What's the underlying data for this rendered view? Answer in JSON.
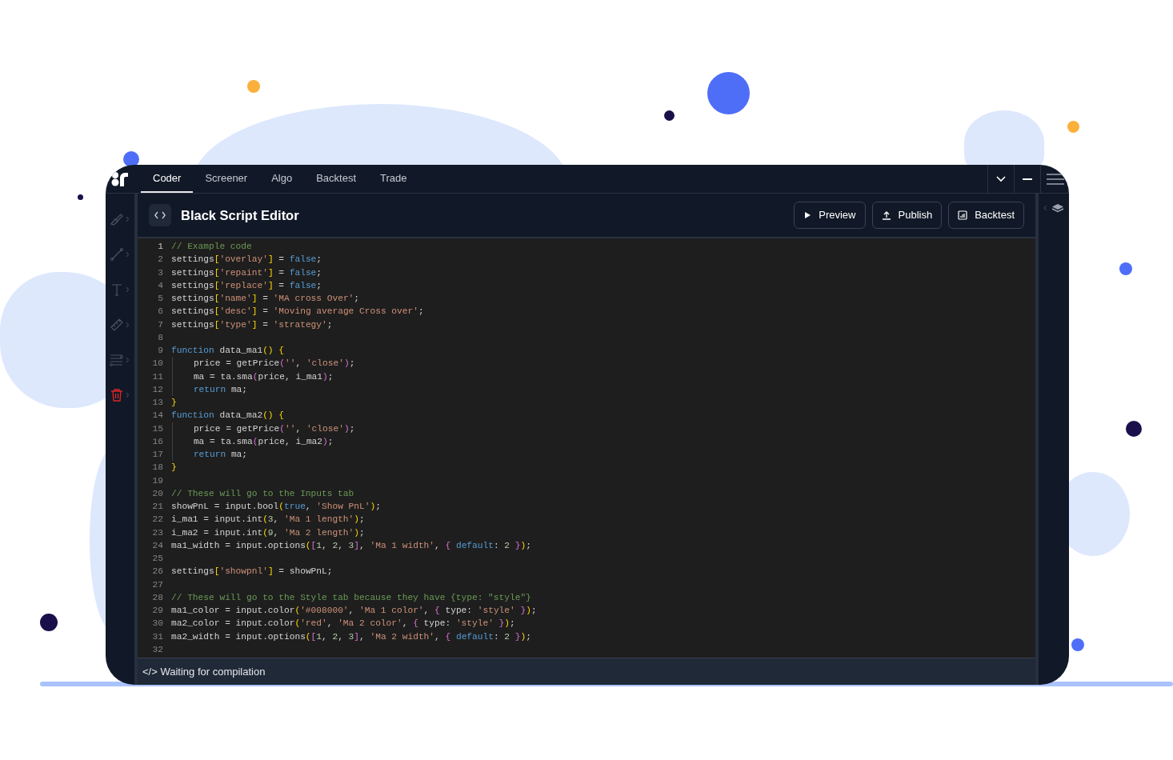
{
  "tabs": [
    {
      "label": "Coder",
      "selected": true
    },
    {
      "label": "Screener",
      "selected": false
    },
    {
      "label": "Algo",
      "selected": false
    },
    {
      "label": "Backtest",
      "selected": false
    },
    {
      "label": "Trade",
      "selected": false
    }
  ],
  "editor": {
    "title": "Black Script Editor",
    "buttons": [
      {
        "label": "Preview",
        "kind": "play"
      },
      {
        "label": "Publish",
        "kind": "upload"
      },
      {
        "label": "Backtest",
        "kind": "chart"
      }
    ]
  },
  "tools": [
    {
      "kind": "brush",
      "danger": false
    },
    {
      "kind": "line",
      "danger": false
    },
    {
      "kind": "text",
      "danger": false
    },
    {
      "kind": "ruler",
      "danger": false
    },
    {
      "kind": "sliders",
      "danger": false
    },
    {
      "kind": "trash",
      "danger": true
    }
  ],
  "code_lines": [
    {
      "number": "1",
      "active": true,
      "indented": false,
      "tokens": [
        {
          "kind": "comment",
          "t": "// Example code"
        }
      ]
    },
    {
      "number": "2",
      "active": false,
      "indented": false,
      "tokens": [
        {
          "kind": "plain",
          "t": "settings"
        },
        {
          "kind": "br1",
          "t": "["
        },
        {
          "kind": "str",
          "t": "'overlay'"
        },
        {
          "kind": "br1",
          "t": "]"
        },
        {
          "kind": "plain",
          "t": " = "
        },
        {
          "kind": "kw",
          "t": "false"
        },
        {
          "kind": "plain",
          "t": ";"
        }
      ]
    },
    {
      "number": "3",
      "active": false,
      "indented": false,
      "tokens": [
        {
          "kind": "plain",
          "t": "settings"
        },
        {
          "kind": "br1",
          "t": "["
        },
        {
          "kind": "str",
          "t": "'repaint'"
        },
        {
          "kind": "br1",
          "t": "]"
        },
        {
          "kind": "plain",
          "t": " = "
        },
        {
          "kind": "kw",
          "t": "false"
        },
        {
          "kind": "plain",
          "t": ";"
        }
      ]
    },
    {
      "number": "4",
      "active": false,
      "indented": false,
      "tokens": [
        {
          "kind": "plain",
          "t": "settings"
        },
        {
          "kind": "br1",
          "t": "["
        },
        {
          "kind": "str",
          "t": "'replace'"
        },
        {
          "kind": "br1",
          "t": "]"
        },
        {
          "kind": "plain",
          "t": " = "
        },
        {
          "kind": "kw",
          "t": "false"
        },
        {
          "kind": "plain",
          "t": ";"
        }
      ]
    },
    {
      "number": "5",
      "active": false,
      "indented": false,
      "tokens": [
        {
          "kind": "plain",
          "t": "settings"
        },
        {
          "kind": "br1",
          "t": "["
        },
        {
          "kind": "str",
          "t": "'name'"
        },
        {
          "kind": "br1",
          "t": "]"
        },
        {
          "kind": "plain",
          "t": " = "
        },
        {
          "kind": "str",
          "t": "'MA cross Over'"
        },
        {
          "kind": "plain",
          "t": ";"
        }
      ]
    },
    {
      "number": "6",
      "active": false,
      "indented": false,
      "tokens": [
        {
          "kind": "plain",
          "t": "settings"
        },
        {
          "kind": "br1",
          "t": "["
        },
        {
          "kind": "str",
          "t": "'desc'"
        },
        {
          "kind": "br1",
          "t": "]"
        },
        {
          "kind": "plain",
          "t": " = "
        },
        {
          "kind": "str",
          "t": "'Moving average Cross over'"
        },
        {
          "kind": "plain",
          "t": ";"
        }
      ]
    },
    {
      "number": "7",
      "active": false,
      "indented": false,
      "tokens": [
        {
          "kind": "plain",
          "t": "settings"
        },
        {
          "kind": "br1",
          "t": "["
        },
        {
          "kind": "str",
          "t": "'type'"
        },
        {
          "kind": "br1",
          "t": "]"
        },
        {
          "kind": "plain",
          "t": " = "
        },
        {
          "kind": "str",
          "t": "'strategy'"
        },
        {
          "kind": "plain",
          "t": ";"
        }
      ]
    },
    {
      "number": "8",
      "active": false,
      "indented": false
    },
    {
      "number": "9",
      "active": false,
      "indented": false,
      "tokens": [
        {
          "kind": "kw",
          "t": "function"
        },
        {
          "kind": "plain",
          "t": " data_ma1"
        },
        {
          "kind": "br1",
          "t": "() {"
        }
      ]
    },
    {
      "number": "10",
      "active": false,
      "indented": true,
      "tokens": [
        {
          "kind": "plain",
          "t": "price = getPrice"
        },
        {
          "kind": "br2",
          "t": "("
        },
        {
          "kind": "str",
          "t": "''"
        },
        {
          "kind": "plain",
          "t": ", "
        },
        {
          "kind": "str",
          "t": "'close'"
        },
        {
          "kind": "br2",
          "t": ")"
        },
        {
          "kind": "plain",
          "t": ";"
        }
      ]
    },
    {
      "number": "11",
      "active": false,
      "indented": true,
      "tokens": [
        {
          "kind": "plain",
          "t": "ma = ta.sma"
        },
        {
          "kind": "br2",
          "t": "("
        },
        {
          "kind": "plain",
          "t": "price, i_ma1"
        },
        {
          "kind": "br2",
          "t": ")"
        },
        {
          "kind": "plain",
          "t": ";"
        }
      ]
    },
    {
      "number": "12",
      "active": false,
      "indented": true,
      "tokens": [
        {
          "kind": "kw",
          "t": "return"
        },
        {
          "kind": "plain",
          "t": " ma;"
        }
      ]
    },
    {
      "number": "13",
      "active": false,
      "indented": false,
      "tokens": [
        {
          "kind": "br1",
          "t": "}"
        }
      ]
    },
    {
      "number": "14",
      "active": false,
      "indented": false,
      "tokens": [
        {
          "kind": "kw",
          "t": "function"
        },
        {
          "kind": "plain",
          "t": " data_ma2"
        },
        {
          "kind": "br1",
          "t": "() {"
        }
      ]
    },
    {
      "number": "15",
      "active": false,
      "indented": true,
      "tokens": [
        {
          "kind": "plain",
          "t": "price = getPrice"
        },
        {
          "kind": "br2",
          "t": "("
        },
        {
          "kind": "str",
          "t": "''"
        },
        {
          "kind": "plain",
          "t": ", "
        },
        {
          "kind": "str",
          "t": "'close'"
        },
        {
          "kind": "br2",
          "t": ")"
        },
        {
          "kind": "plain",
          "t": ";"
        }
      ]
    },
    {
      "number": "16",
      "active": false,
      "indented": true,
      "tokens": [
        {
          "kind": "plain",
          "t": "ma = ta.sma"
        },
        {
          "kind": "br2",
          "t": "("
        },
        {
          "kind": "plain",
          "t": "price, i_ma2"
        },
        {
          "kind": "br2",
          "t": ")"
        },
        {
          "kind": "plain",
          "t": ";"
        }
      ]
    },
    {
      "number": "17",
      "active": false,
      "indented": true,
      "tokens": [
        {
          "kind": "kw",
          "t": "return"
        },
        {
          "kind": "plain",
          "t": " ma;"
        }
      ]
    },
    {
      "number": "18",
      "active": false,
      "indented": false,
      "tokens": [
        {
          "kind": "br1",
          "t": "}"
        }
      ]
    },
    {
      "number": "19",
      "active": false,
      "indented": false
    },
    {
      "number": "20",
      "active": false,
      "indented": false,
      "tokens": [
        {
          "kind": "comment",
          "t": "// These will go to the Inputs tab"
        }
      ]
    },
    {
      "number": "21",
      "active": false,
      "indented": false,
      "tokens": [
        {
          "kind": "plain",
          "t": "showPnL = input.bool"
        },
        {
          "kind": "br1",
          "t": "("
        },
        {
          "kind": "kw",
          "t": "true"
        },
        {
          "kind": "plain",
          "t": ", "
        },
        {
          "kind": "str",
          "t": "'Show PnL'"
        },
        {
          "kind": "br1",
          "t": ")"
        },
        {
          "kind": "plain",
          "t": ";"
        }
      ]
    },
    {
      "number": "22",
      "active": false,
      "indented": false,
      "tokens": [
        {
          "kind": "plain",
          "t": "i_ma1 = input.int"
        },
        {
          "kind": "br1",
          "t": "("
        },
        {
          "kind": "num",
          "t": "3"
        },
        {
          "kind": "plain",
          "t": ", "
        },
        {
          "kind": "str",
          "t": "'Ma 1 length'"
        },
        {
          "kind": "br1",
          "t": ")"
        },
        {
          "kind": "plain",
          "t": ";"
        }
      ]
    },
    {
      "number": "23",
      "active": false,
      "indented": false,
      "tokens": [
        {
          "kind": "plain",
          "t": "i_ma2 = input.int"
        },
        {
          "kind": "br1",
          "t": "("
        },
        {
          "kind": "num",
          "t": "9"
        },
        {
          "kind": "plain",
          "t": ", "
        },
        {
          "kind": "str",
          "t": "'Ma 2 length'"
        },
        {
          "kind": "br1",
          "t": ")"
        },
        {
          "kind": "plain",
          "t": ";"
        }
      ]
    },
    {
      "number": "24",
      "active": false,
      "indented": false,
      "tokens": [
        {
          "kind": "plain",
          "t": "ma1_width = input.options"
        },
        {
          "kind": "br1",
          "t": "("
        },
        {
          "kind": "br2",
          "t": "["
        },
        {
          "kind": "num",
          "t": "1"
        },
        {
          "kind": "plain",
          "t": ", "
        },
        {
          "kind": "num",
          "t": "2"
        },
        {
          "kind": "plain",
          "t": ", "
        },
        {
          "kind": "num",
          "t": "3"
        },
        {
          "kind": "br2",
          "t": "]"
        },
        {
          "kind": "plain",
          "t": ", "
        },
        {
          "kind": "str",
          "t": "'Ma 1 width'"
        },
        {
          "kind": "plain",
          "t": ", "
        },
        {
          "kind": "br2",
          "t": "{"
        },
        {
          "kind": "kw",
          "t": " default"
        },
        {
          "kind": "plain",
          "t": ": "
        },
        {
          "kind": "num",
          "t": "2"
        },
        {
          "kind": "br2",
          "t": " }"
        },
        {
          "kind": "br1",
          "t": ")"
        },
        {
          "kind": "plain",
          "t": ";"
        }
      ]
    },
    {
      "number": "25",
      "active": false,
      "indented": false
    },
    {
      "number": "26",
      "active": false,
      "indented": false,
      "tokens": [
        {
          "kind": "plain",
          "t": "settings"
        },
        {
          "kind": "br1",
          "t": "["
        },
        {
          "kind": "str",
          "t": "'showpnl'"
        },
        {
          "kind": "br1",
          "t": "]"
        },
        {
          "kind": "plain",
          "t": " = showPnL;"
        }
      ]
    },
    {
      "number": "27",
      "active": false,
      "indented": false
    },
    {
      "number": "28",
      "active": false,
      "indented": false,
      "tokens": [
        {
          "kind": "comment",
          "t": "// These will go to the Style tab because they have {type: \"style\"}"
        }
      ]
    },
    {
      "number": "29",
      "active": false,
      "indented": false,
      "tokens": [
        {
          "kind": "plain",
          "t": "ma1_color = input.color"
        },
        {
          "kind": "br1",
          "t": "("
        },
        {
          "kind": "str",
          "t": "'#008000'"
        },
        {
          "kind": "plain",
          "t": ", "
        },
        {
          "kind": "str",
          "t": "'Ma 1 color'"
        },
        {
          "kind": "plain",
          "t": ", "
        },
        {
          "kind": "br2",
          "t": "{"
        },
        {
          "kind": "plain",
          "t": " type: "
        },
        {
          "kind": "str",
          "t": "'style'"
        },
        {
          "kind": "br2",
          "t": " }"
        },
        {
          "kind": "br1",
          "t": ")"
        },
        {
          "kind": "plain",
          "t": ";"
        }
      ]
    },
    {
      "number": "30",
      "active": false,
      "indented": false,
      "tokens": [
        {
          "kind": "plain",
          "t": "ma2_color = input.color"
        },
        {
          "kind": "br1",
          "t": "("
        },
        {
          "kind": "str",
          "t": "'red'"
        },
        {
          "kind": "plain",
          "t": ", "
        },
        {
          "kind": "str",
          "t": "'Ma 2 color'"
        },
        {
          "kind": "plain",
          "t": ", "
        },
        {
          "kind": "br2",
          "t": "{"
        },
        {
          "kind": "plain",
          "t": " type: "
        },
        {
          "kind": "str",
          "t": "'style'"
        },
        {
          "kind": "br2",
          "t": " }"
        },
        {
          "kind": "br1",
          "t": ")"
        },
        {
          "kind": "plain",
          "t": ";"
        }
      ]
    },
    {
      "number": "31",
      "active": false,
      "indented": false,
      "tokens": [
        {
          "kind": "plain",
          "t": "ma2_width = input.options"
        },
        {
          "kind": "br1",
          "t": "("
        },
        {
          "kind": "br2",
          "t": "["
        },
        {
          "kind": "num",
          "t": "1"
        },
        {
          "kind": "plain",
          "t": ", "
        },
        {
          "kind": "num",
          "t": "2"
        },
        {
          "kind": "plain",
          "t": ", "
        },
        {
          "kind": "num",
          "t": "3"
        },
        {
          "kind": "br2",
          "t": "]"
        },
        {
          "kind": "plain",
          "t": ", "
        },
        {
          "kind": "str",
          "t": "'Ma 2 width'"
        },
        {
          "kind": "plain",
          "t": ", "
        },
        {
          "kind": "br2",
          "t": "{"
        },
        {
          "kind": "kw",
          "t": " default"
        },
        {
          "kind": "plain",
          "t": ": "
        },
        {
          "kind": "num",
          "t": "2"
        },
        {
          "kind": "br2",
          "t": " }"
        },
        {
          "kind": "br1",
          "t": ")"
        },
        {
          "kind": "plain",
          "t": ";"
        }
      ]
    },
    {
      "number": "32",
      "active": false,
      "indented": false
    }
  ],
  "status_bar": {
    "text": "</> Waiting for compilation"
  }
}
